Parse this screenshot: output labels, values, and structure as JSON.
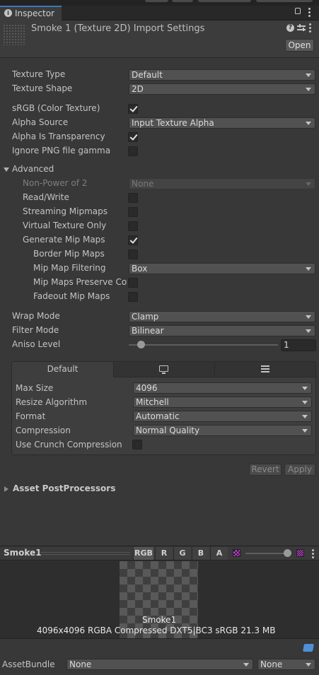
{
  "tab": {
    "label": "Inspector"
  },
  "header": {
    "title": "Smoke 1 (Texture 2D) Import Settings",
    "open_label": "Open"
  },
  "settings": [
    {
      "label": "Texture Type",
      "value": "Default"
    },
    {
      "label": "Texture Shape",
      "value": "2D"
    },
    {
      "label": "sRGB (Color Texture)",
      "checked": true
    },
    {
      "label": "Alpha Source",
      "value": "Input Texture Alpha"
    },
    {
      "label": "Alpha Is Transparency",
      "checked": true
    },
    {
      "label": "Ignore PNG file gamma",
      "checked": false
    }
  ],
  "advanced": {
    "label": "Advanced",
    "non_power_of_2": {
      "label": "Non-Power of 2",
      "value": "None"
    },
    "read_write": {
      "label": "Read/Write",
      "checked": false
    },
    "streaming_mipmaps": {
      "label": "Streaming Mipmaps",
      "checked": false
    },
    "virtual_texture_only": {
      "label": "Virtual Texture Only",
      "checked": false
    },
    "generate_mip_maps": {
      "label": "Generate Mip Maps",
      "checked": true
    },
    "border_mip_maps": {
      "label": "Border Mip Maps",
      "checked": false
    },
    "mip_map_filtering": {
      "label": "Mip Map Filtering",
      "value": "Box"
    },
    "mip_maps_preserve_coverage": {
      "label": "Mip Maps Preserve Cov",
      "checked": false
    },
    "fadeout_mip_maps": {
      "label": "Fadeout Mip Maps",
      "checked": false
    }
  },
  "wrap_mode": {
    "label": "Wrap Mode",
    "value": "Clamp"
  },
  "filter_mode": {
    "label": "Filter Mode",
    "value": "Bilinear"
  },
  "aniso_level": {
    "label": "Aniso Level",
    "value": "1",
    "slider_fraction": 0.06
  },
  "platform": {
    "tabs": [
      {
        "label": "Default",
        "icon": "default-tab"
      },
      {
        "icon": "monitor-icon"
      },
      {
        "icon": "server-icon"
      }
    ],
    "max_size": {
      "label": "Max Size",
      "value": "4096"
    },
    "resize_algorithm": {
      "label": "Resize Algorithm",
      "value": "Mitchell"
    },
    "format": {
      "label": "Format",
      "value": "Automatic"
    },
    "compression": {
      "label": "Compression",
      "value": "Normal Quality"
    },
    "use_crunch": {
      "label": "Use Crunch Compression",
      "checked": false
    }
  },
  "buttons": {
    "revert": "Revert",
    "apply": "Apply"
  },
  "asset_postprocessors": {
    "label": "Asset PostProcessors"
  },
  "preview": {
    "name": "Smoke1",
    "channels": [
      "RGB",
      "R",
      "G",
      "B",
      "A"
    ],
    "texture_label": "Smoke1",
    "info": "4096x4096  RGBA Compressed DXT5|BC3 sRGB   21.3 MB",
    "mip_fraction": 0.93
  },
  "asset_bundle": {
    "label": "AssetBundle",
    "name": "None",
    "variant": "None"
  },
  "colors": {
    "accent": "#3a79bb",
    "checker_dark": "#3f3f3f",
    "checker_light": "#595959"
  }
}
